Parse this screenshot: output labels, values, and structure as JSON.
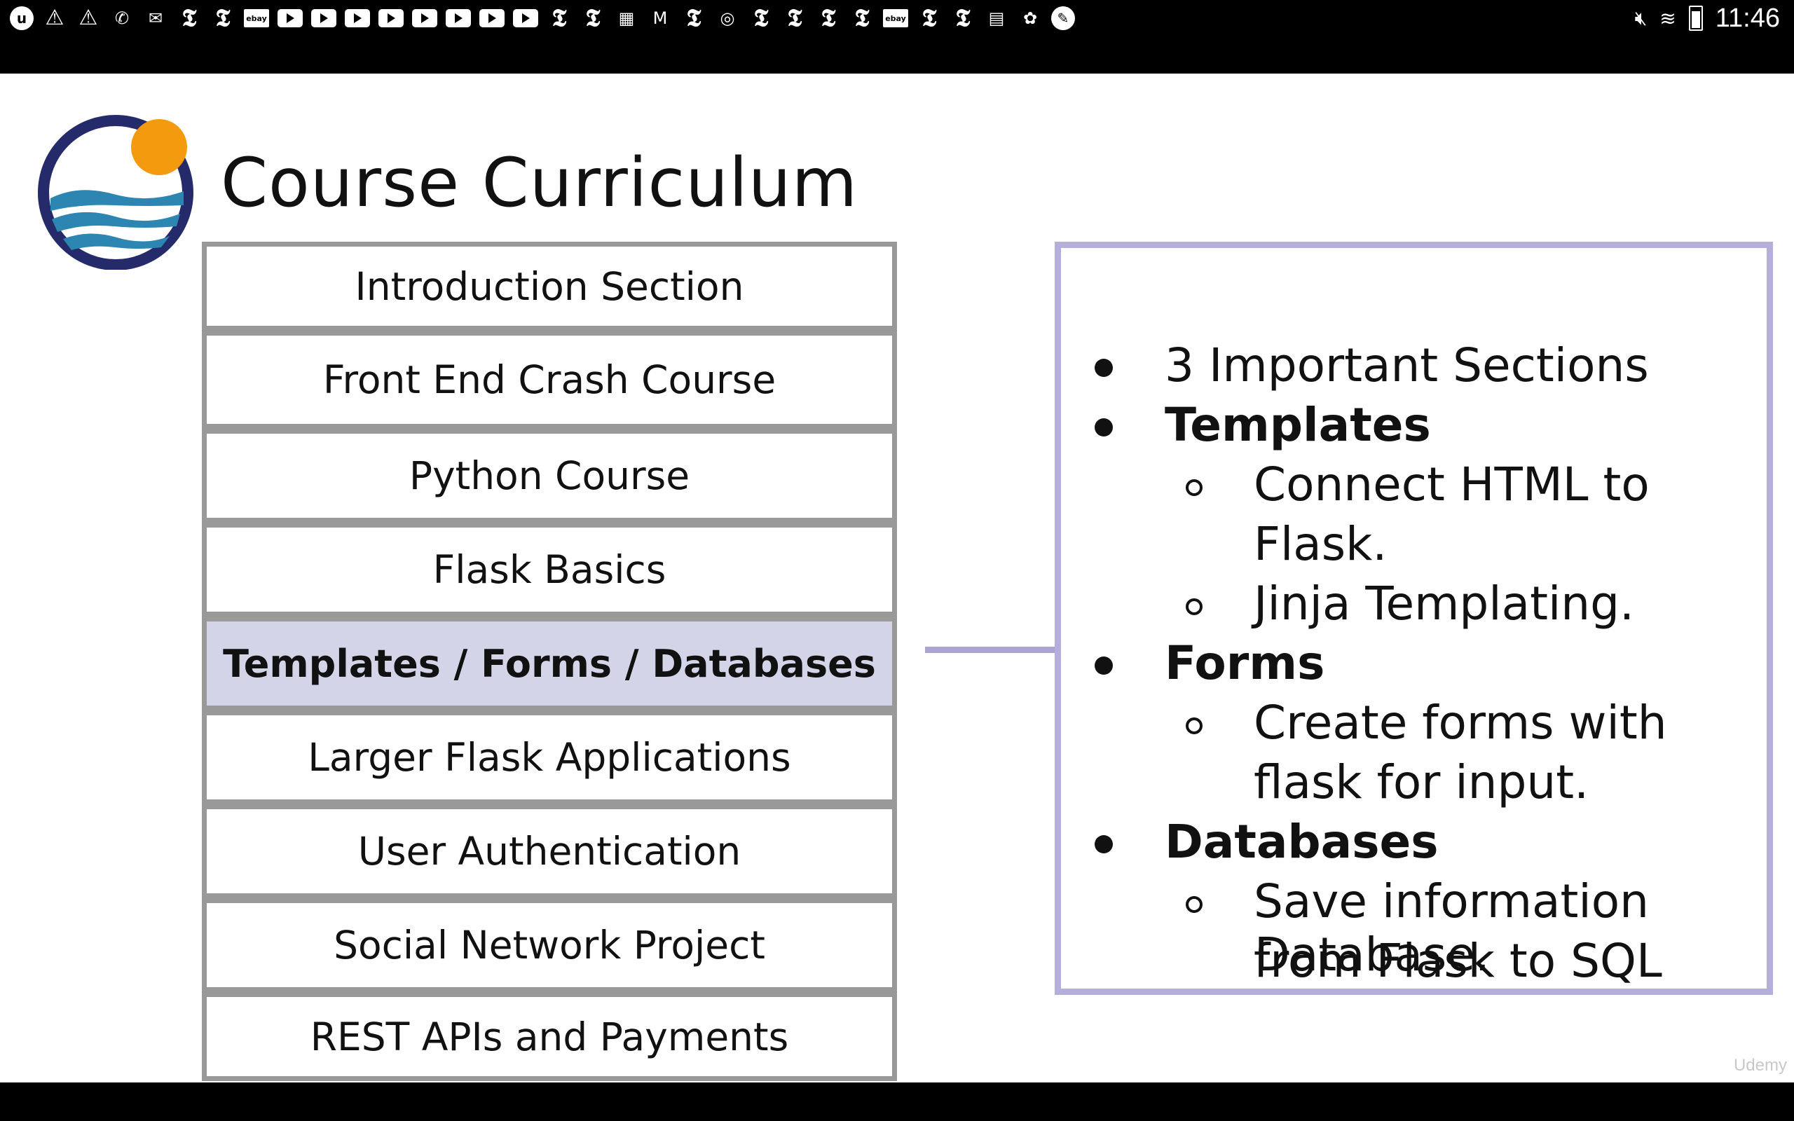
{
  "status_bar": {
    "notification_icons": [
      "udemy-icon",
      "warning-icon",
      "warning-icon",
      "phone-icon",
      "email-icon",
      "nyt-icon",
      "nyt-icon",
      "ebay-icon",
      "youtube-icon",
      "youtube-icon",
      "youtube-icon",
      "youtube-icon",
      "youtube-icon",
      "youtube-icon",
      "youtube-icon",
      "youtube-icon",
      "nyt-icon",
      "nyt-icon",
      "image-icon",
      "gmail-icon",
      "nyt-icon",
      "instagram-icon",
      "nyt-icon",
      "nyt-icon",
      "nyt-icon",
      "nyt-icon",
      "ebay-icon",
      "nyt-icon",
      "nyt-icon",
      "news-icon",
      "bug-icon",
      "compass-icon"
    ],
    "time": "11:46"
  },
  "slide": {
    "title": "Course Curriculum",
    "curriculum": [
      {
        "label": "Introduction Section",
        "active": false
      },
      {
        "label": "Front End Crash Course",
        "active": false
      },
      {
        "label": "Python Course",
        "active": false
      },
      {
        "label": "Flask Basics",
        "active": false
      },
      {
        "label": "Templates / Forms / Databases",
        "active": true
      },
      {
        "label": "Larger Flask Applications",
        "active": false
      },
      {
        "label": "User Authentication",
        "active": false
      },
      {
        "label": "Social Network Project",
        "active": false
      },
      {
        "label": "REST APIs and Payments",
        "active": false
      }
    ],
    "details": {
      "intro": "3 Important Sections",
      "templates": "Templates",
      "templates_sub1_line1": "Connect HTML to",
      "templates_sub1_line2": "Flask.",
      "templates_sub2": "Jinja Templating.",
      "forms": "Forms",
      "forms_sub1_line1": "Create forms with",
      "forms_sub1_line2": "flask for input.",
      "databases": "Databases",
      "databases_sub1_line1": "Save information",
      "databases_sub1_line2": "from Flask to SQL",
      "databases_sub1_line3": "Database."
    },
    "watermark": "Udemy"
  },
  "colors": {
    "active_row": "#d4d4e8",
    "accent_border": "#b3afda",
    "row_border": "#999999",
    "logo_navy": "#252a6b",
    "logo_orange": "#f39a0f",
    "logo_wave": "#2d86b2"
  }
}
